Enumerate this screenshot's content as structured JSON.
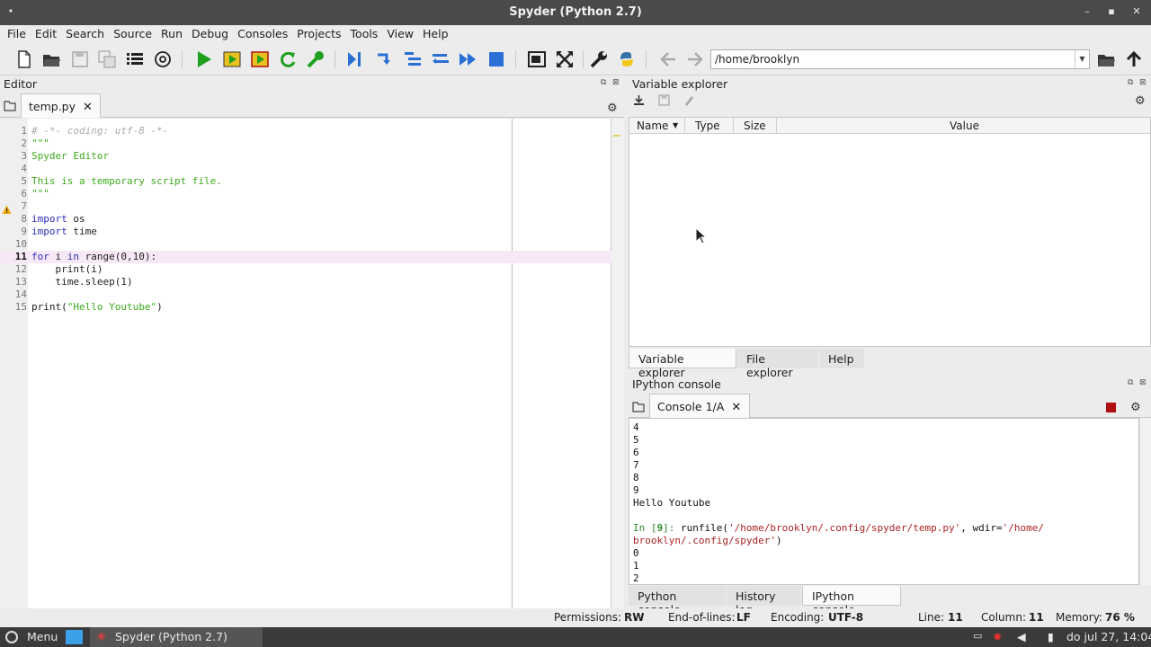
{
  "window": {
    "title": "Spyder (Python 2.7)",
    "dot": "•",
    "min": "–",
    "max": "▪",
    "close": "✕"
  },
  "menu": [
    "File",
    "Edit",
    "Search",
    "Source",
    "Run",
    "Debug",
    "Consoles",
    "Projects",
    "Tools",
    "View",
    "Help"
  ],
  "toolbar": {
    "path": "/home/brooklyn",
    "dropdown": "▼"
  },
  "editor": {
    "pane_title": "Editor",
    "tab": "temp.py",
    "close_glyph": "✕",
    "current_line": 11,
    "lines": [
      "# -*- coding: utf-8 -*-",
      "\"\"\"",
      "Spyder Editor",
      "",
      "This is a temporary script file.",
      "\"\"\"",
      "",
      "import os",
      "import time",
      "",
      "for i in range(0,10):",
      "    print(i)",
      "    time.sleep(1)",
      "",
      "print(\"Hello Youtube\")"
    ]
  },
  "variable_explorer": {
    "pane_title": "Variable explorer",
    "columns": [
      "Name",
      "Type",
      "Size",
      "Value"
    ],
    "sort_glyph": "▼",
    "tabs": [
      "Variable explorer",
      "File explorer",
      "Help"
    ]
  },
  "ipython": {
    "pane_title": "IPython console",
    "tab": "Console 1/A",
    "close_glyph": "✕",
    "output_before": [
      "4",
      "5",
      "6",
      "7",
      "8",
      "9",
      "Hello Youtube",
      ""
    ],
    "prompt": "In [9]: ",
    "cmd_prefix": "runfile(",
    "cmd_str1": "'/home/brooklyn/.config/spyder/temp.py'",
    "cmd_mid": ", wdir=",
    "cmd_str2a": "'/home/",
    "cmd_str2b": "brooklyn/.config/spyder'",
    "cmd_end": ")",
    "output_after": [
      "0",
      "1",
      "2"
    ],
    "tabs": [
      "Python console",
      "History log",
      "IPython console"
    ]
  },
  "status": {
    "permissions_label": "Permissions:",
    "permissions": "RW",
    "eol_label": "End-of-lines:",
    "eol": "LF",
    "encoding_label": "Encoding:",
    "encoding": "UTF-8",
    "line_label": "Line:",
    "line": "11",
    "column_label": "Column:",
    "column": "11",
    "memory_label": "Memory:",
    "memory": "76 %"
  },
  "taskbar": {
    "menu": "Menu",
    "app": "Spyder (Python 2.7)",
    "clock": "do jul 27, 14:04"
  },
  "colors": {
    "run_green": "#1fa01f",
    "accent_blue": "#2a6fd6",
    "stop_red": "#b01010"
  }
}
